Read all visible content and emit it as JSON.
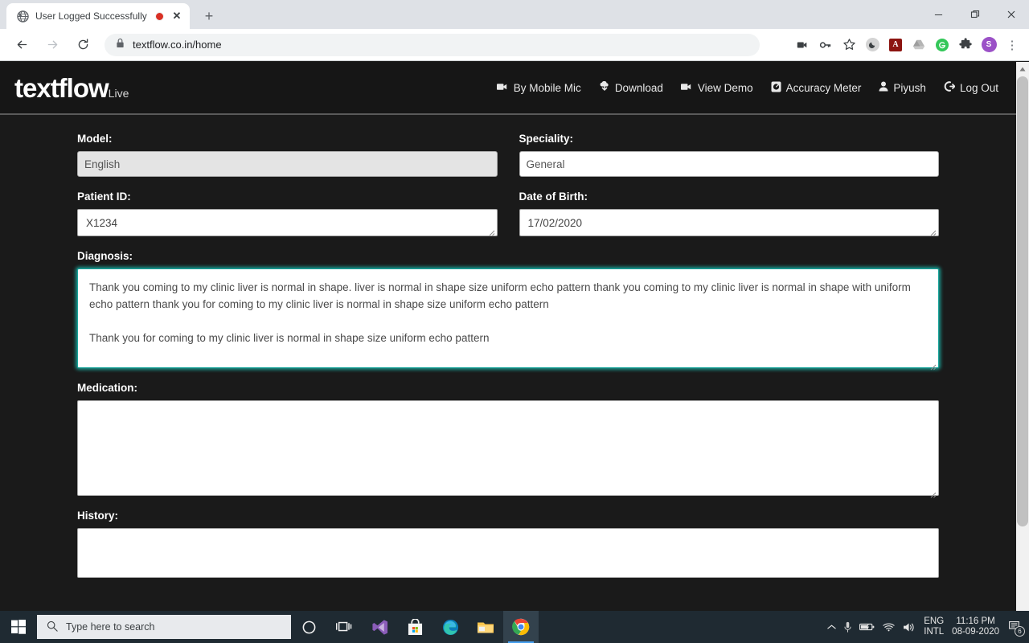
{
  "browser": {
    "tab": {
      "favicon": "globe-icon",
      "title": "User Logged Successfully",
      "recording_indicator": "recording-dot-icon",
      "close_label": "✕"
    },
    "new_tab_label": "+",
    "window_controls": {
      "minimize": "—",
      "maximize": "❐",
      "close": "✕"
    },
    "nav": {
      "back": "←",
      "forward": "→",
      "reload": "⟳"
    },
    "omnibox": {
      "lock": "lock-icon",
      "url": "textflow.co.in/home"
    },
    "toolbar_icons": [
      "camera-video-icon",
      "key-icon",
      "star-icon",
      "dark-mode-icon",
      "adobe-acrobat-icon",
      "google-drive-icon",
      "grammarly-icon",
      "extensions-puzzle-icon"
    ],
    "profile_avatar": {
      "initial": "S",
      "color": "#9b51c7"
    },
    "menu": "⋮"
  },
  "site": {
    "logo": {
      "text": "textflow",
      "suffix": "Live"
    },
    "nav": [
      {
        "label": "By Mobile Mic",
        "icon": "video-camera-icon"
      },
      {
        "label": "Download",
        "icon": "download-cloud-icon"
      },
      {
        "label": "View Demo",
        "icon": "video-camera-icon"
      },
      {
        "label": "Accuracy Meter",
        "icon": "meter-gauge-icon"
      },
      {
        "label": "Piyush",
        "icon": "user-icon"
      },
      {
        "label": "Log Out",
        "icon": "logout-icon"
      }
    ]
  },
  "form": {
    "model": {
      "label": "Model:",
      "value": "English",
      "options": [
        "English"
      ],
      "dropdown_icon": "chevron-down-icon"
    },
    "speciality": {
      "label": "Speciality:",
      "value": "General",
      "options": [
        "General"
      ],
      "dropdown_icon": "chevron-down-icon"
    },
    "patient_id": {
      "label": "Patient ID:",
      "value": "X1234",
      "placeholder": ""
    },
    "date_of_birth": {
      "label": "Date of Birth:",
      "value": "17/02/2020",
      "placeholder": ""
    },
    "diagnosis": {
      "label": "Diagnosis:",
      "paragraph_1": "Thank you coming to my clinic liver is normal in shape. liver is normal in shape size uniform echo pattern thank you coming to my clinic liver is normal in shape with uniform echo pattern thank you for coming to my clinic liver is normal in shape size uniform echo pattern",
      "paragraph_2": "Thank you for coming to my clinic liver is normal in shape size uniform echo pattern",
      "focused": true,
      "focus_color": "#16a39a"
    },
    "medication": {
      "label": "Medication:",
      "value": "",
      "placeholder": ""
    },
    "history": {
      "label": "History:",
      "value": "",
      "placeholder": ""
    }
  },
  "taskbar": {
    "start": "windows-logo-icon",
    "search": {
      "icon": "search-icon",
      "placeholder": "Type here to search"
    },
    "apps": [
      {
        "name": "cortana-icon"
      },
      {
        "name": "task-view-icon"
      },
      {
        "name": "vs-code-icon"
      },
      {
        "name": "microsoft-store-icon"
      },
      {
        "name": "microsoft-edge-icon"
      },
      {
        "name": "file-explorer-icon"
      },
      {
        "name": "google-chrome-icon"
      }
    ],
    "tray": {
      "show_hidden": "chevron-up-icon",
      "microphone": "microphone-icon",
      "battery": "battery-charging-icon",
      "network": "wifi-icon",
      "volume": "speaker-icon",
      "language_line1": "ENG",
      "language_line2": "INTL",
      "time": "11:16 PM",
      "date": "08-09-2020",
      "notifications_icon": "action-center-icon",
      "notifications_count": "6"
    }
  }
}
